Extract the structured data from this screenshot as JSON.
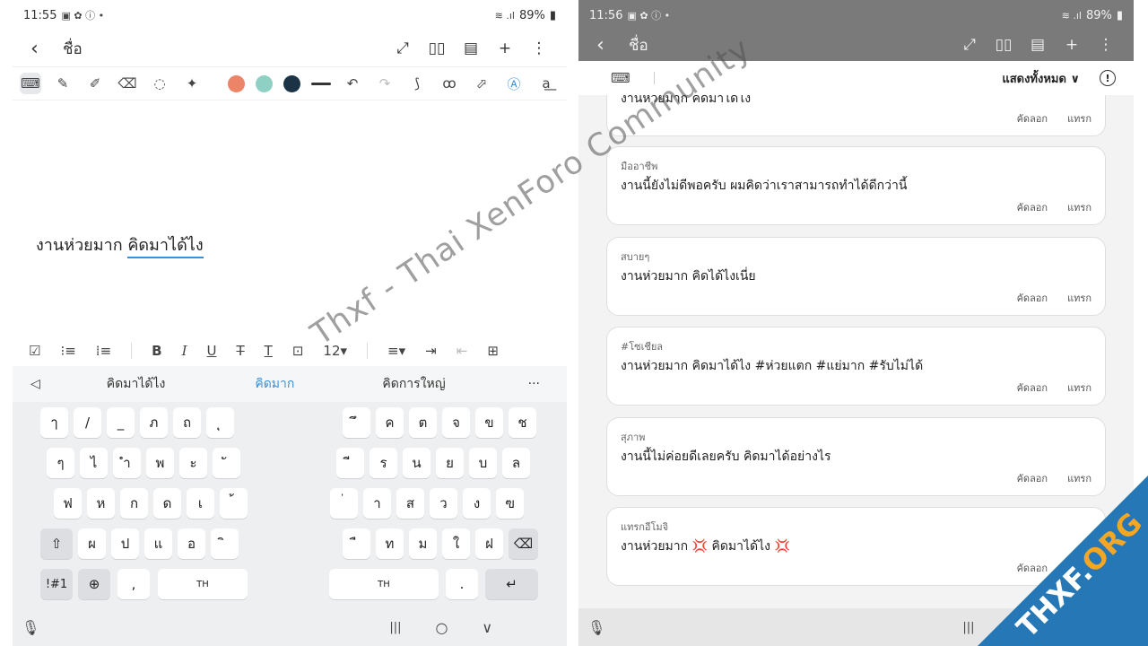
{
  "left": {
    "status": {
      "time": "11:55",
      "icons": "▣ ✿ ⓘ •",
      "right": "89%",
      "signal": "≋ .ıl"
    },
    "appbar": {
      "back": "‹",
      "title": "ชื่อ",
      "actions": [
        "⤢",
        "▯▯",
        "▤",
        "+",
        "⋮"
      ]
    },
    "pen_tools": [
      "⌨",
      "✎",
      "✐",
      "⌫",
      "◌",
      "✦"
    ],
    "colors": [
      "#ec8467",
      "#8fd0c4",
      "#1b3344"
    ],
    "pen_tools_right": [
      "↶",
      "↷",
      "⟆",
      "ꝏ",
      "⬀",
      "Ⓐ",
      "a͟"
    ],
    "note": {
      "plain": "งานห่วยมาก ",
      "underlined": "คิดมาได้ไง"
    },
    "format": {
      "check": "☑",
      "numlist": "⁝≡",
      "bullets": "⁞≡",
      "bold": "B",
      "italic": "I",
      "underline": "U",
      "strike": "T",
      "texttool": "T",
      "boxT": "⊡",
      "size": "12▾",
      "align": "≡▾",
      "indent": "⇥",
      "outdent": "⇤",
      "last": "⊞"
    },
    "suggestions": {
      "back": "◁",
      "s1": "คิดมาได้ไง",
      "s2": "คิดมาก",
      "s3": "คิดการใหญ่",
      "more": "···"
    },
    "keys": {
      "r1l": [
        "ๅ",
        "/",
        "_",
        "ภ",
        "ถ",
        "ุ"
      ],
      "r1r": [
        "ึ",
        "ค",
        "ต",
        "จ",
        "ข",
        "ช"
      ],
      "r2l": [
        "ๆ",
        "ไ",
        "ำ",
        "พ",
        "ะ",
        "ั"
      ],
      "r2r": [
        "ี",
        "ร",
        "น",
        "ย",
        "บ",
        "ล"
      ],
      "r3l": [
        "ฟ",
        "ห",
        "ก",
        "ด",
        "เ",
        "้"
      ],
      "r3r": [
        "่",
        "า",
        "ส",
        "ว",
        "ง",
        "ฃ"
      ],
      "r4l": [
        "ผ",
        "ป",
        "แ",
        "อ",
        "ิ"
      ],
      "r4r": [
        "ื",
        "ท",
        "ม",
        "ใ",
        "ฝ"
      ],
      "shift": "⇧",
      "del": "⌫",
      "sym": "!#1",
      "globe": "⊕",
      "comma": ",",
      "space_l": "TH",
      "space_r": "TH",
      "dot": ".",
      "enter": "↵"
    },
    "nav": {
      "mic": "🎙",
      "recents": "|||",
      "home": "○",
      "back": "∨"
    }
  },
  "right": {
    "status": {
      "time": "11:56",
      "icons": "▣ ✿ ⓘ •",
      "right": "89%",
      "signal": "≋ .ıl"
    },
    "appbar": {
      "back": "‹",
      "title": "ชื่อ",
      "actions": [
        "⤢",
        "▯▯",
        "▤",
        "+",
        "⋮"
      ]
    },
    "header": {
      "kbd": "⌨",
      "filter": "แสดงทั้งหมด ∨",
      "info": "!"
    },
    "cards": [
      {
        "tag": "",
        "text": "งานห่วยมาก คิดมาได้ไง",
        "copy": "คัดลอก",
        "insert": "แทรก"
      },
      {
        "tag": "มืออาชีพ",
        "text": "งานนี้ยังไม่ดีพอครับ ผมคิดว่าเราสามารถทำได้ดีกว่านี้",
        "copy": "คัดลอก",
        "insert": "แทรก"
      },
      {
        "tag": "สบายๆ",
        "text": "งานห่วยมาก คิดได้ไงเนี่ย",
        "copy": "คัดลอก",
        "insert": "แทรก"
      },
      {
        "tag": "#โซเชียล",
        "text": "งานห่วยมาก คิดมาได้ไง #ห่วยแตก #แย่มาก #รับไม่ได้",
        "copy": "คัดลอก",
        "insert": "แทรก"
      },
      {
        "tag": "สุภาพ",
        "text": "งานนี้ไม่ค่อยดีเลยครับ คิดมาได้อย่างไร",
        "copy": "คัดลอก",
        "insert": "แทรก"
      },
      {
        "tag": "แทรกอีโมจิ",
        "text": "งานห่วยมาก 💢 คิดมาได้ไง 💢",
        "copy": "คัดลอก",
        "insert": "แทรก"
      }
    ],
    "nav": {
      "mic": "🎙",
      "recents": "|||",
      "home": "○",
      "back": "∨"
    }
  },
  "watermark": {
    "text": "Thxf - Thai XenForo Community",
    "corner_main": "THXF.",
    "corner_org": "ORG"
  }
}
